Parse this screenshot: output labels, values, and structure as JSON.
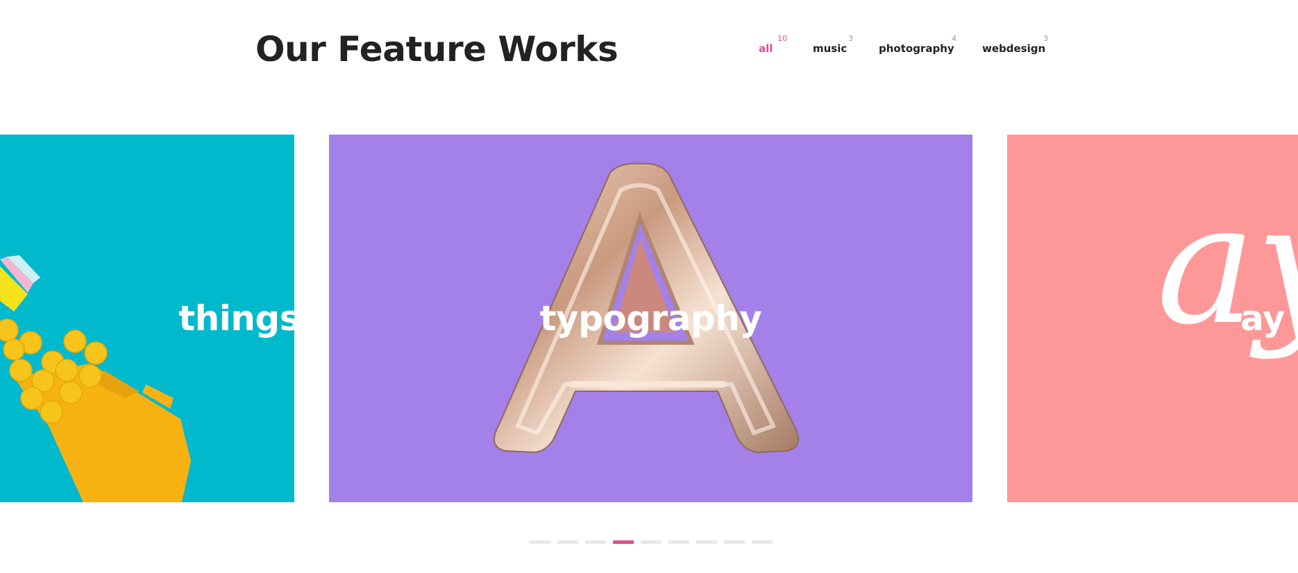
{
  "header": {
    "title": "Our Feature Works"
  },
  "filters": [
    {
      "label": "all",
      "count": "10",
      "active": true
    },
    {
      "label": "music",
      "count": "3",
      "active": false
    },
    {
      "label": "photography",
      "count": "4",
      "active": false
    },
    {
      "label": "webdesign",
      "count": "3",
      "active": false
    }
  ],
  "slides": [
    {
      "label": "things",
      "background": "#00b9cc",
      "image": "yellow-paintbrush-icon"
    },
    {
      "label": "typography",
      "background": "#a381e9",
      "image": "gold-balloon-letter-a-icon"
    },
    {
      "label": "ay",
      "background": "#fe9898",
      "image": "script-lettering-icon",
      "decor_text": "ay"
    }
  ],
  "pagination": {
    "total": 10,
    "active_index": 4
  },
  "colors": {
    "accent": "#e24c94",
    "text": "#222222",
    "muted": "#999999"
  }
}
